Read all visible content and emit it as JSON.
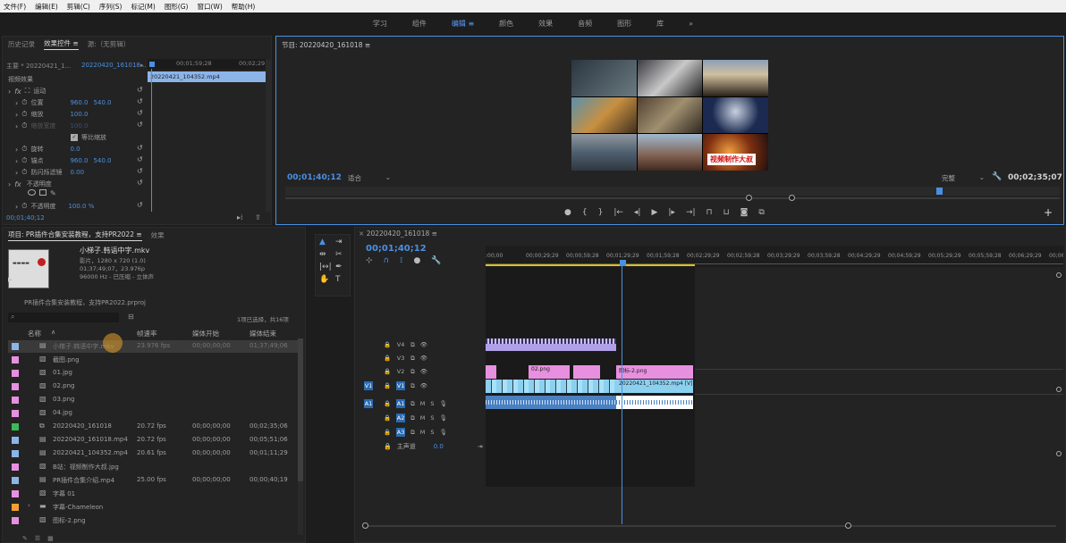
{
  "menu": [
    "文件(F)",
    "编辑(E)",
    "剪辑(C)",
    "序列(S)",
    "标记(M)",
    "图形(G)",
    "窗口(W)",
    "帮助(H)"
  ],
  "workspaces": [
    {
      "label": "学习",
      "active": false
    },
    {
      "label": "组件",
      "active": false
    },
    {
      "label": "编辑",
      "active": true
    },
    {
      "label": "颜色",
      "active": false
    },
    {
      "label": "效果",
      "active": false
    },
    {
      "label": "音频",
      "active": false
    },
    {
      "label": "图形",
      "active": false
    },
    {
      "label": "库",
      "active": false
    },
    {
      "label": "»",
      "active": false
    }
  ],
  "effect_controls": {
    "tabs": [
      "历史记录",
      "效果控件",
      "源:（无剪辑）"
    ],
    "menu_icon": "≡",
    "source_label": "主要 * 20220421_1...",
    "sequence_label": "20220420_161018...",
    "ruler_time": "00;01;59;28",
    "ruler_time2": "00;02;29",
    "clip_name": "20220421_104352.mp4",
    "section_video": "视频效果",
    "motion": "运动",
    "rows": [
      {
        "label": "位置",
        "v1": "960.0",
        "v2": "540.0"
      },
      {
        "label": "缩放",
        "v1": "100.0",
        "v2": ""
      },
      {
        "label": "缩放宽度",
        "v1": "100.0",
        "v2": ""
      },
      {
        "label": "等比缩放",
        "v1": "",
        "v2": ""
      },
      {
        "label": "旋转",
        "v1": "0.0",
        "v2": ""
      },
      {
        "label": "锚点",
        "v1": "960.0",
        "v2": "540.0"
      },
      {
        "label": "防闪烁滤镜",
        "v1": "0.00",
        "v2": ""
      }
    ],
    "opacity_label": "不透明度",
    "opacity_row": {
      "label": "不透明度",
      "v1": "100.0 %"
    },
    "timecode": "00;01;40;12"
  },
  "program": {
    "title": "节目: 20220420_161018",
    "menu_icon": "≡",
    "timecode": "00;01;40;12",
    "fit": "适合",
    "quality": "完整",
    "duration": "00;02;35;07",
    "caption": "视频制作大叔",
    "add": "+"
  },
  "project": {
    "tabs": [
      "项目: PR插件合集安装教程，支持PR2022",
      "效果"
    ],
    "menu_icon": "≡",
    "preview_name": "小梯子.韩语中字.mkv",
    "preview_type": "影片，1280 x 720 (1.0)",
    "preview_dur": "01;37;49;07，23.976p",
    "preview_audio": "96000 Hz - 已压缩 - 立体声",
    "project_file": "PR插件合集安装教程，支持PR2022.prproj",
    "selection": "1项已选择，共16项",
    "columns": [
      "名称",
      "帧速率",
      "媒体开始",
      "媒体结束"
    ],
    "items": [
      {
        "color": "#8cb4e8",
        "icon": "film",
        "name": "小梯子.韩语中字.mkv",
        "fps": "23.976 fps",
        "start": "00;00;00;00",
        "end": "01;37;49;06",
        "selected": true
      },
      {
        "color": "#e890e0",
        "icon": "img",
        "name": "截图.png",
        "fps": "",
        "start": "",
        "end": "",
        "selected": false
      },
      {
        "color": "#e890e0",
        "icon": "img",
        "name": "01.jpg",
        "fps": "",
        "start": "",
        "end": "",
        "selected": false
      },
      {
        "color": "#e890e0",
        "icon": "img",
        "name": "02.png",
        "fps": "",
        "start": "",
        "end": "",
        "selected": false
      },
      {
        "color": "#e890e0",
        "icon": "img",
        "name": "03.png",
        "fps": "",
        "start": "",
        "end": "",
        "selected": false
      },
      {
        "color": "#e890e0",
        "icon": "img",
        "name": "04.jpg",
        "fps": "",
        "start": "",
        "end": "",
        "selected": false
      },
      {
        "color": "#3cb85a",
        "icon": "seq",
        "name": "20220420_161018",
        "fps": "20.72 fps",
        "start": "00;00;00;00",
        "end": "00;02;35;06",
        "selected": false
      },
      {
        "color": "#8cb4e8",
        "icon": "film",
        "name": "20220420_161018.mp4",
        "fps": "20.72 fps",
        "start": "00;00;00;00",
        "end": "00;05;51;06",
        "selected": false
      },
      {
        "color": "#8cb4e8",
        "icon": "film",
        "name": "20220421_104352.mp4",
        "fps": "20.61 fps",
        "start": "00;00;00;00",
        "end": "00;01;11;29",
        "selected": false
      },
      {
        "color": "#e890e0",
        "icon": "img",
        "name": "B站：视频制作大叔.jpg",
        "fps": "",
        "start": "",
        "end": "",
        "selected": false
      },
      {
        "color": "#8cb4e8",
        "icon": "film",
        "name": "PR插件合集介绍.mp4",
        "fps": "25.00 fps",
        "start": "00;00;00;00",
        "end": "00;00;40;19",
        "selected": false
      },
      {
        "color": "#e890e0",
        "icon": "img",
        "name": "字幕 01",
        "fps": "",
        "start": "",
        "end": "",
        "selected": false
      },
      {
        "color": "#f0a030",
        "icon": "folder",
        "name": "字幕-Chameleon",
        "fps": "",
        "start": "",
        "end": "",
        "selected": false
      },
      {
        "color": "#e890e0",
        "icon": "img",
        "name": "图标-2.png",
        "fps": "",
        "start": "",
        "end": "",
        "selected": false
      }
    ]
  },
  "timeline": {
    "title": "20220420_161018",
    "menu_icon": "≡",
    "timecode": "00;01;40;12",
    "ruler": [
      ":00;00",
      "00;00;29;29",
      "00;00;59;28",
      "00;01;29;29",
      "00;01;59;28",
      "00;02;29;29",
      "00;02;59;28",
      "00;03;29;29",
      "00;03;59;28",
      "00;04;29;29",
      "00;04;59;29",
      "00;05;29;29",
      "00;05;59;28",
      "00;06;29;29",
      "00;06"
    ],
    "video_tracks": [
      "V4",
      "V3",
      "V2",
      "V1"
    ],
    "audio_tracks": [
      "A1",
      "A2",
      "A3"
    ],
    "source_v": "V1",
    "source_a": "A1",
    "master": "主声道",
    "master_val": "0.0",
    "clips": {
      "v2a": "02.png",
      "v2b": "图标-2.png",
      "v1": "20220421_104352.mp4 [V]"
    }
  }
}
